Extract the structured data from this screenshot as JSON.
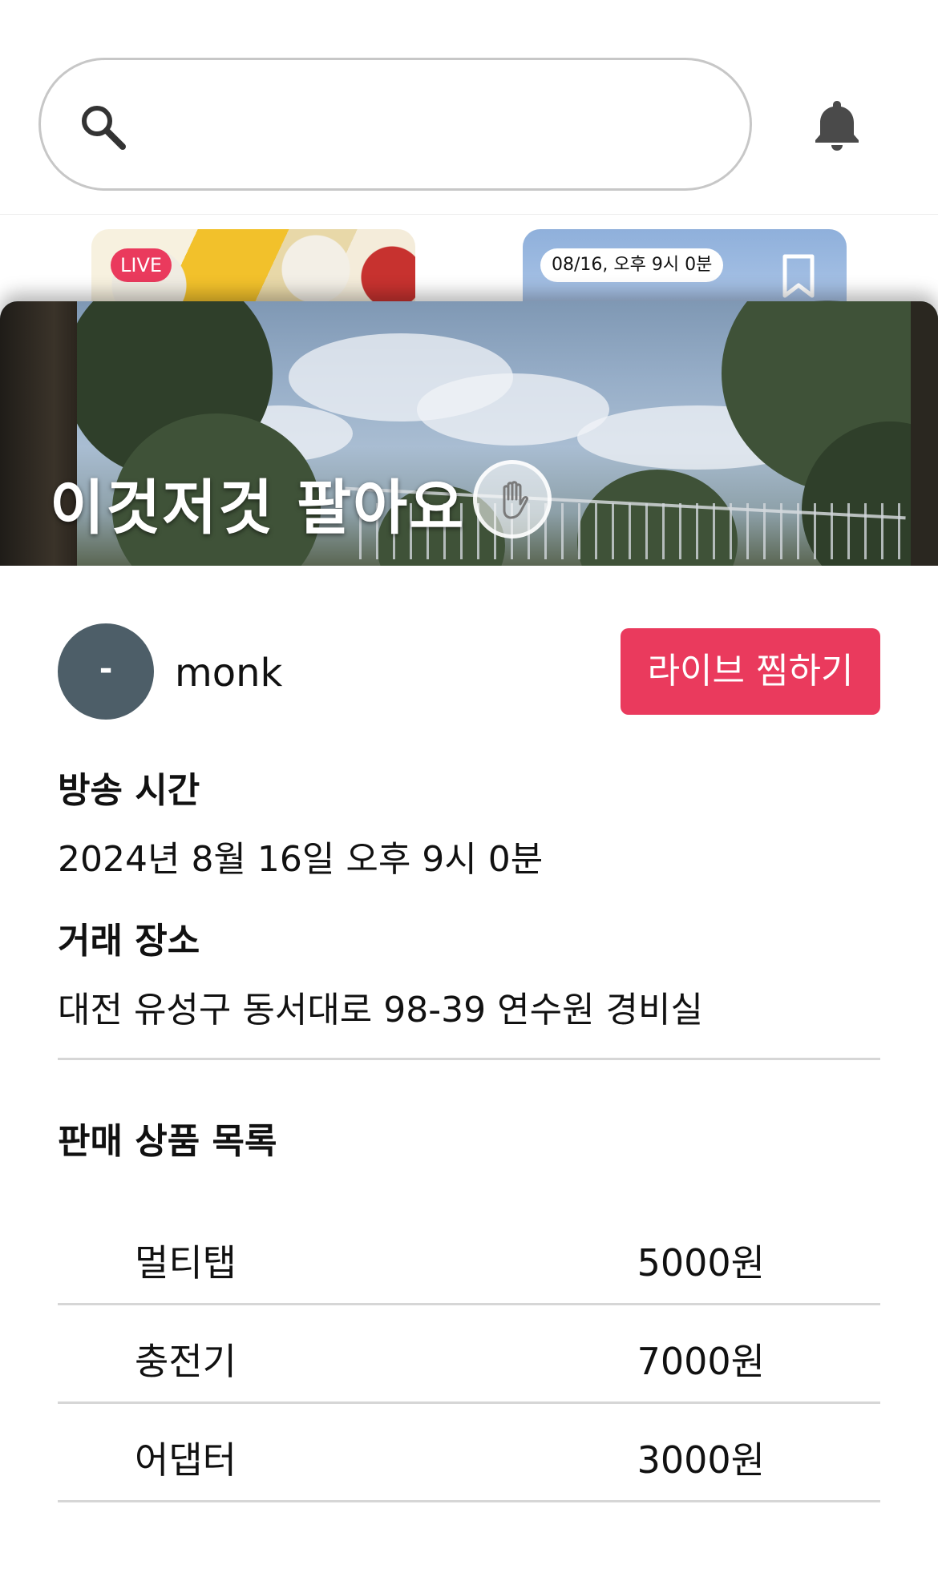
{
  "search": {
    "placeholder": ""
  },
  "cards": [
    {
      "badge": "LIVE"
    },
    {
      "badge": "08/16, 오후 9시 0분"
    }
  ],
  "live": {
    "title": "이것저것 팔아요",
    "host": {
      "avatar_text": "-",
      "name": "monk"
    },
    "like_button": "라이브 찜하기",
    "broadcast_time": {
      "label": "방송 시간",
      "value": "2024년 8월 16일 오후 9시 0분"
    },
    "location": {
      "label": "거래 장소",
      "value": "대전 유성구 동서대로 98-39 연수원 경비실"
    },
    "products_title": "판매 상품 목록",
    "products": [
      {
        "name": "멀티탭",
        "price": "5000원"
      },
      {
        "name": "충전기",
        "price": "7000원"
      },
      {
        "name": "어댑터",
        "price": "3000원"
      }
    ]
  },
  "colors": {
    "accent": "#ea3a5d",
    "avatar_bg": "#4d5e68",
    "divider": "#d6d6d6"
  },
  "icons": {
    "search": "search-icon",
    "notifications": "bell-icon",
    "bookmark": "bookmark-icon",
    "hand": "hand-icon"
  }
}
